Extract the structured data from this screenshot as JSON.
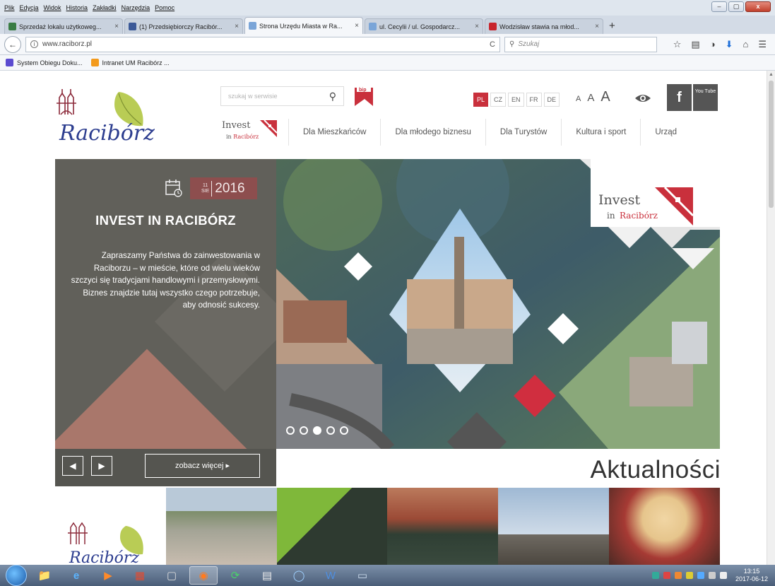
{
  "browser": {
    "menu": [
      "Plik",
      "Edycja",
      "Widok",
      "Historia",
      "Zakładki",
      "Narzędzia",
      "Pomoc"
    ],
    "window_buttons": {
      "minimize": "–",
      "maximize": "▢",
      "close": "x"
    },
    "tabs": [
      {
        "label": "Sprzedaż lokalu użytkoweg...",
        "close": "×",
        "icon_color": "#3a7d44"
      },
      {
        "label": "(1) Przedsiębiorczy Racibór...",
        "close": "×",
        "icon_color": "#3b5998"
      },
      {
        "label": "Strona Urzędu Miasta w Ra...",
        "close": "×",
        "icon_color": "#7aa5d8"
      },
      {
        "label": "ul. Cecylii / ul. Gospodarcz...",
        "close": "×",
        "icon_color": "#7aa5d8"
      },
      {
        "label": "Wodzisław stawia na młod...",
        "close": "×",
        "icon_color": "#c8242c"
      }
    ],
    "new_tab": "+",
    "back": "←",
    "url": "www.raciborz.pl",
    "reload": "C",
    "search_placeholder": "Szukaj",
    "bookmarks": [
      {
        "label": "System Obiegu Doku...",
        "icon_color": "#5b4bd0"
      },
      {
        "label": "Intranet UM Racibórz ...",
        "icon_color": "#f39a1c"
      }
    ]
  },
  "site": {
    "search_placeholder": "szukaj w serwisie",
    "bip_label": "bip",
    "languages": [
      "PL",
      "CZ",
      "EN",
      "FR",
      "DE"
    ],
    "active_language": "PL",
    "font_sizes": [
      "A",
      "A",
      "A"
    ],
    "facebook": "f",
    "youtube": "You Tube",
    "logo_text": "Racibórz",
    "invest_logo": {
      "line1": "Invest",
      "line2_prefix": "in",
      "line2_city": "Racibórz"
    },
    "nav": [
      "Dla Mieszkańców",
      "Dla młodego biznesu",
      "Dla Turystów",
      "Kultura i sport",
      "Urząd"
    ],
    "slide": {
      "day": "11",
      "month": "SIE",
      "year": "2016",
      "title": "INVEST IN RACIBÓRZ",
      "text": "Zapraszamy Państwa do zainwestowania w Raciborzu – w mieście, które od wielu wieków szczyci się tradycjami handlowymi i przemysłowymi. Biznes znajdzie tutaj wszystko czego potrzebuje, aby odnosić sukcesy.",
      "prev": "◀",
      "next": "▶",
      "more": "zobacz więcej ▸",
      "dots_count": 5,
      "active_dot": 3
    },
    "news_heading": "Aktualności",
    "accent_color": "#c9303c"
  },
  "taskbar": {
    "time": "13:15",
    "date": "2017-06-12"
  }
}
